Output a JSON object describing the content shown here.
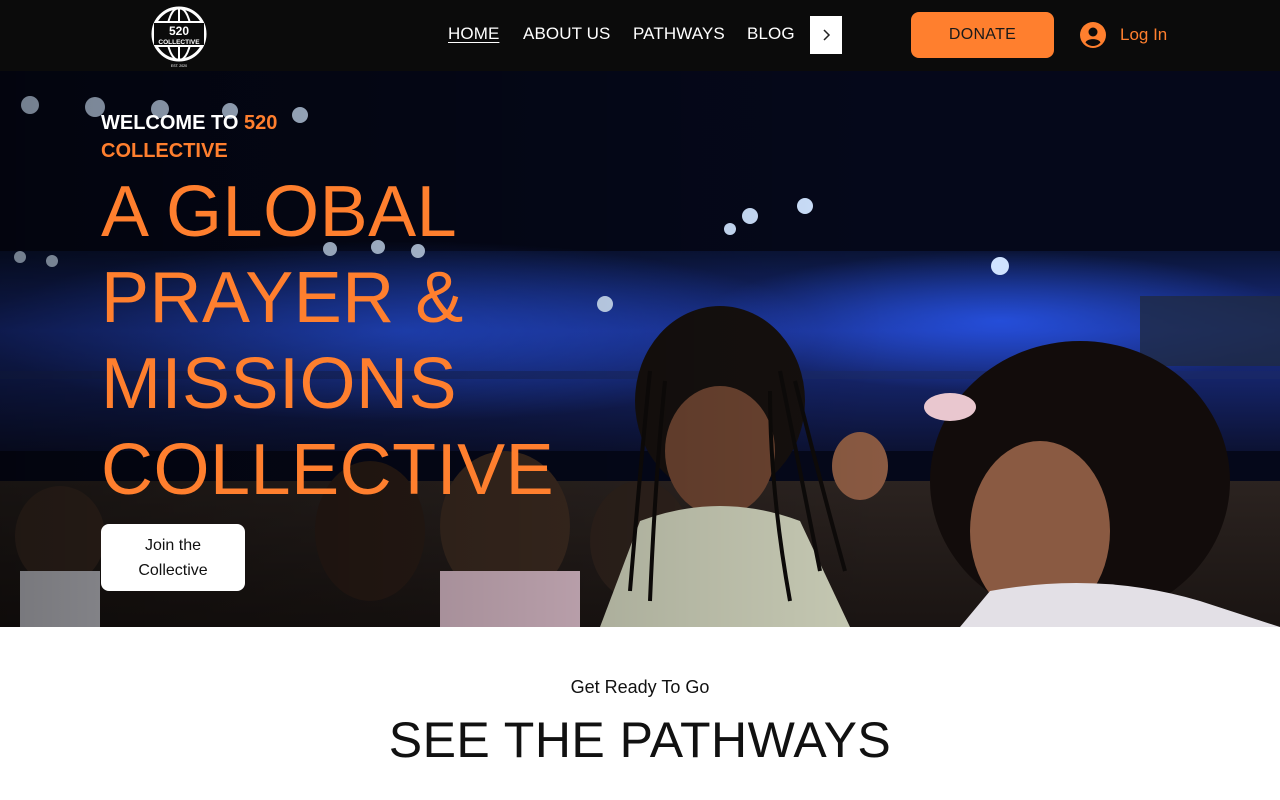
{
  "header": {
    "logo": {
      "text": "520",
      "subtext": "COLLECTIVE",
      "est": "EST. 2020"
    },
    "nav": [
      {
        "label": "HOME",
        "active": true
      },
      {
        "label": "ABOUT US",
        "active": false
      },
      {
        "label": "PATHWAYS",
        "active": false
      },
      {
        "label": "BLOG",
        "active": false
      }
    ],
    "nav_next_icon": "chevron-right-icon",
    "donate_label": "DONATE",
    "login_label": "Log In",
    "login_icon": "user-avatar-icon"
  },
  "hero": {
    "eyebrow_prefix": "WELCOME TO ",
    "eyebrow_accent": "520 COLLECTIVE",
    "headline": "A GLOBAL PRAYER & MISSIONS COLLECTIVE",
    "cta_label": "Join the Collective"
  },
  "pathways": {
    "kicker": "Get Ready To Go",
    "title": "SEE THE PATHWAYS"
  },
  "colors": {
    "accent": "#ff7f2e",
    "header_bg": "#0b0b0b",
    "text_dark": "#111111"
  }
}
